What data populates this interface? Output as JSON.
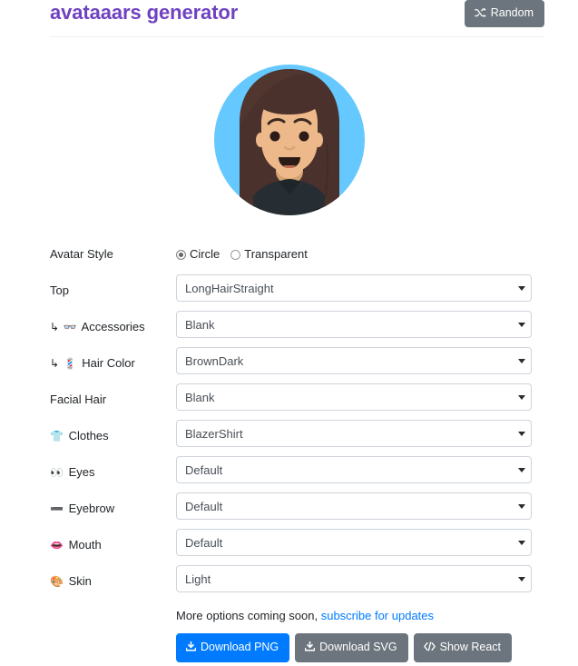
{
  "header": {
    "title": "avataaars generator",
    "random_button": {
      "label": "Random",
      "icon": "shuffle-icon"
    }
  },
  "avatar": {
    "alt": "generated avatar preview",
    "background_color": "#65C9FF",
    "skin_color": "#EDB98A",
    "hair_color": "#4A312C",
    "clothes_color": "#262E33",
    "style": "Circle"
  },
  "avatar_style": {
    "label": "Avatar Style",
    "options": [
      {
        "label": "Circle",
        "selected": true
      },
      {
        "label": "Transparent",
        "selected": false
      }
    ]
  },
  "fields": [
    {
      "label": "Top",
      "emoji": "",
      "sub": false,
      "value": "LongHairStraight",
      "name": "top"
    },
    {
      "label": "Accessories",
      "emoji": "👓",
      "sub": true,
      "value": "Blank",
      "name": "accessories"
    },
    {
      "label": "Hair Color",
      "emoji": "💈",
      "sub": true,
      "value": "BrownDark",
      "name": "hair-color"
    },
    {
      "label": "Facial Hair",
      "emoji": "",
      "sub": false,
      "value": "Blank",
      "name": "facial-hair"
    },
    {
      "label": "Clothes",
      "emoji": "👕",
      "sub": false,
      "value": "BlazerShirt",
      "name": "clothes"
    },
    {
      "label": "Eyes",
      "emoji": "👀",
      "sub": false,
      "value": "Default",
      "name": "eyes"
    },
    {
      "label": "Eyebrow",
      "emoji": "➖",
      "sub": false,
      "value": "Default",
      "name": "eyebrow"
    },
    {
      "label": "Mouth",
      "emoji": "👄",
      "sub": false,
      "value": "Default",
      "name": "mouth"
    },
    {
      "label": "Skin",
      "emoji": "🎨",
      "sub": false,
      "value": "Light",
      "name": "skin"
    }
  ],
  "footer": {
    "note_text": "More options coming soon,",
    "note_link": "subscribe for updates",
    "buttons": [
      {
        "label": "Download PNG",
        "icon": "download-icon",
        "style": "primary",
        "name": "download-png-button"
      },
      {
        "label": "Download SVG",
        "icon": "download-icon",
        "style": "secondary",
        "name": "download-svg-button"
      },
      {
        "label": "Show React",
        "icon": "code-icon",
        "style": "secondary",
        "name": "show-react-button"
      }
    ]
  },
  "colors": {
    "title": "#6f42c1",
    "primary": "#007bff",
    "secondary": "#6c757d",
    "link": "#007bff",
    "border": "#ced4da"
  }
}
